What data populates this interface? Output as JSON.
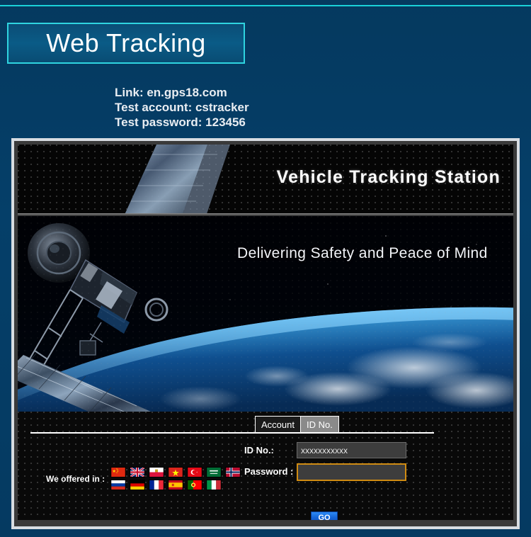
{
  "slide": {
    "title": "Web Tracking",
    "credentials": [
      "Link: en.gps18.com",
      "Test account: cstracker",
      "Test password: 123456"
    ],
    "accent_cyan": "#2fd4e0",
    "background_blue": "#05395f"
  },
  "site": {
    "header_title": "Vehicle Tracking Station",
    "tagline": "Delivering Safety and Peace of Mind",
    "tabs": [
      {
        "label": "Account",
        "active": false
      },
      {
        "label": "ID No.",
        "active": true
      }
    ],
    "form": {
      "id_label": "ID No.:",
      "id_value": "xxxxxxxxxxx",
      "password_label": "Password :",
      "password_value": "",
      "submit_label": "GO"
    },
    "languages": {
      "label": "We offered in :",
      "rows": [
        [
          {
            "name": "china-flag"
          },
          {
            "name": "united-kingdom-flag"
          },
          {
            "name": "poland-flag"
          },
          {
            "name": "vietnam-flag"
          },
          {
            "name": "turkey-flag"
          },
          {
            "name": "saudi-arabia-flag"
          },
          {
            "name": "norway-flag"
          }
        ],
        [
          {
            "name": "russia-flag"
          },
          {
            "name": "germany-flag"
          },
          {
            "name": "france-flag"
          },
          {
            "name": "spain-flag"
          },
          {
            "name": "portugal-flag"
          },
          {
            "name": "italy-flag"
          }
        ]
      ]
    }
  }
}
